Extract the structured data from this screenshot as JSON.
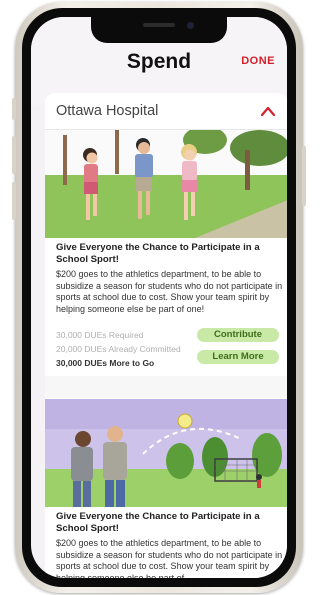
{
  "header": {
    "title": "Spend",
    "done_label": "DONE"
  },
  "card": {
    "title": "Ottawa Hospital",
    "items": [
      {
        "title": "Give Everyone the Chance to Participate in a School Sport!",
        "description": "$200 goes to the athletics department, to be able to subsidize a season for students who do not participate in sports at school due to cost. Show your team spirit by helping someone else be part of one!",
        "required": "30,000 DUEs Required",
        "committed": "20,000 DUEs Already Committed",
        "to_go": "30,000 DUEs More to Go",
        "contribute_label": "Contribute",
        "learn_more_label": "Learn More"
      },
      {
        "title": "Give Everyone the Chance to Participate in a School Sport!",
        "description": "$200 goes to the athletics department, to be able to subsidize a season for students who do not participate in sports at school due to cost. Show your team spirit by helping someone else be part of"
      }
    ]
  },
  "colors": {
    "accent": "#d4202c",
    "pill_bg": "#c9eaa6",
    "pill_text": "#3f6d1a"
  },
  "icons": {
    "collapse": "chevron-up-icon"
  }
}
